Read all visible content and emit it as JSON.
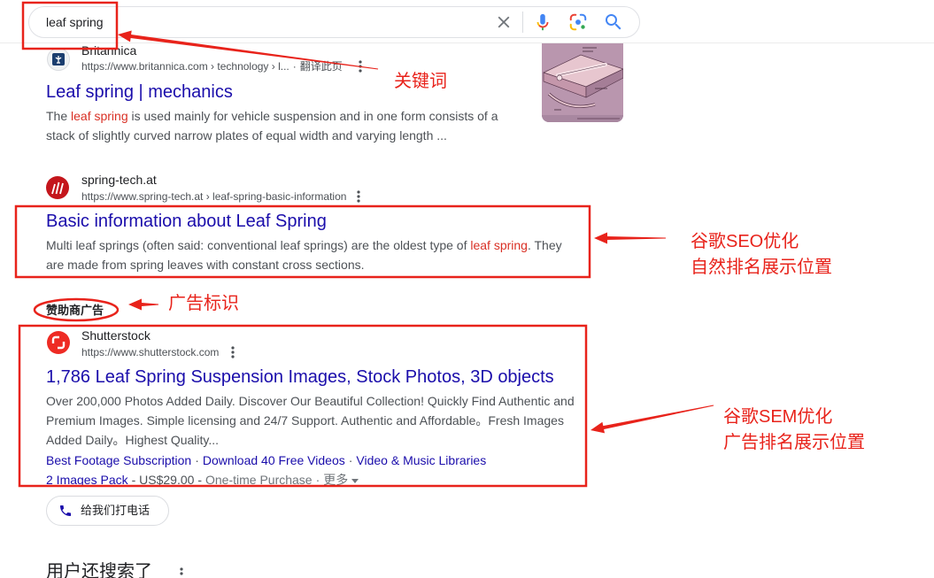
{
  "search": {
    "query": "leaf spring"
  },
  "icons": {
    "clear": "close-icon",
    "mic": "microphone-icon",
    "lens": "camera-lens-icon",
    "search": "search-icon",
    "more": "more-vert-icon",
    "phone": "phone-icon",
    "caret": "caret-down-icon"
  },
  "colors": {
    "link": "#1a0dab",
    "text": "#4d5156",
    "highlight": "#d93025",
    "annotation": "#e8231b"
  },
  "results": [
    {
      "site_name": "Britannica",
      "url": "https://www.britannica.com › technology › l...",
      "sep": "·",
      "translate": "翻译此页",
      "title": "Leaf spring | mechanics",
      "snippet_pre": "The ",
      "snippet_em": "leaf spring",
      "snippet_post": " is used mainly for vehicle suspension and in one form consists of a stack of slightly curved narrow plates of equal width and varying length ..."
    },
    {
      "site_name": "spring-tech.at",
      "url": "https://www.spring-tech.at › leaf-spring-basic-information",
      "title": "Basic information about Leaf Spring",
      "snippet_pre": "Multi leaf springs (often said: conventional leaf springs) are the oldest type of ",
      "snippet_em": "leaf spring",
      "snippet_post": ". They are made from spring leaves with constant cross sections."
    }
  ],
  "ad": {
    "sponsored_label": "赞助商广告",
    "site_name": "Shutterstock",
    "url": "https://www.shutterstock.com",
    "title": "1,786 Leaf Spring Suspension Images, Stock Photos, 3D objects",
    "snippet": "Over 200,000 Photos Added Daily. Discover Our Beautiful Collection! Quickly Find Authentic and Premium Images. Simple licensing and 24/7 Support. Authentic and Affordable。Fresh Images Added Daily。Highest Quality...",
    "sitelinks": [
      "Best Footage Subscription",
      "Download 40 Free Videos",
      "Video & Music Libraries"
    ],
    "sitelink_sep": "·",
    "offer": {
      "link": "2 Images Pack",
      "price": "- US$29.00 -",
      "type": "One-time Purchase",
      "sep": "·",
      "more": "更多"
    },
    "call_button": "给我们打电话"
  },
  "related": {
    "heading": "用户还搜索了"
  },
  "annotations": {
    "keyword": "关键词",
    "seo_line1": "谷歌SEO优化",
    "seo_line2": "自然排名展示位置",
    "ad_label": "广告标识",
    "sem_line1": "谷歌SEM优化",
    "sem_line2": "广告排名展示位置",
    "color": "#e8231b"
  }
}
